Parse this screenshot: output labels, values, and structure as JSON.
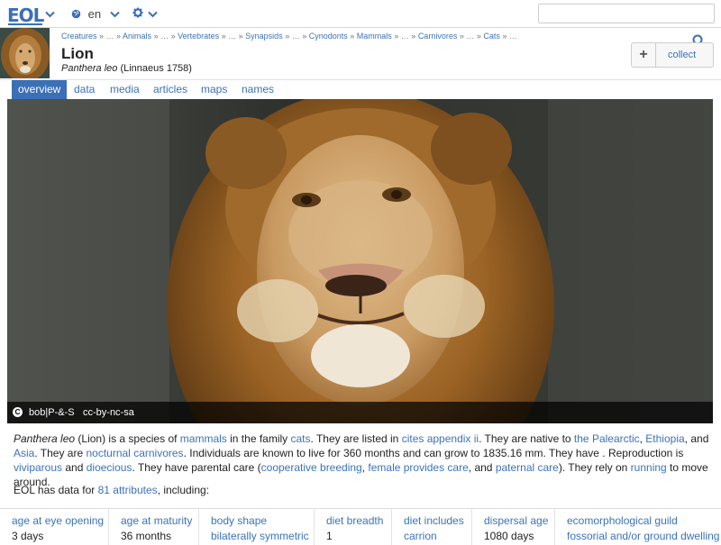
{
  "topbar": {
    "logo": "EOL",
    "language": "en",
    "search_placeholder": ""
  },
  "header": {
    "breadcrumb": [
      "Creatures",
      "…",
      "Animals",
      "…",
      "Vertebrates",
      "…",
      "Synapsids",
      "…",
      "Cynodonts",
      "Mammals",
      "…",
      "Carnivores",
      "…",
      "Cats",
      "…"
    ],
    "title": "Lion",
    "scientific_name": "Panthera leo",
    "authority": "(Linnaeus 1758)",
    "collect_label": "collect"
  },
  "tabs": [
    {
      "label": "overview",
      "active": true
    },
    {
      "label": "data",
      "active": false
    },
    {
      "label": "media",
      "active": false
    },
    {
      "label": "articles",
      "active": false
    },
    {
      "label": "maps",
      "active": false
    },
    {
      "label": "names",
      "active": false
    }
  ],
  "hero": {
    "credit_author": "bob|P-&-S",
    "credit_license": "cc-by-nc-sa"
  },
  "description": {
    "s1": "Panthera leo",
    "s2": " (Lion) is a species of ",
    "l_mammals": "mammals",
    "s3": " in the family ",
    "l_cats": "cats",
    "s4": ". They are listed in ",
    "l_cites": "cites appendix ii",
    "s5": ". They are native to ",
    "l_palearctic": "the Palearctic",
    "s6": ", ",
    "l_ethiopia": "Ethiopia",
    "s7": ", and ",
    "l_asia": "Asia",
    "s8": ". They are ",
    "l_nocturnal": "nocturnal",
    "s9": " ",
    "l_carnivores": "carnivores",
    "s10": ". Individuals are known to live for 360 months and can grow to 1835.16 mm. They have . Reproduction is ",
    "l_viviparous": "viviparous",
    "s11": " and ",
    "l_dioecious": "dioecious",
    "s12": ". They have parental care (",
    "l_coop": "cooperative breeding",
    "s13": ", ",
    "l_female": "female provides care",
    "s14": ", and ",
    "l_paternal": "paternal care",
    "s15": "). They rely on ",
    "l_running": "running",
    "s16": " to move around."
  },
  "data_intro": {
    "prefix": "EOL has data for ",
    "link": "81 attributes",
    "suffix": ", including:"
  },
  "attributes": [
    {
      "name": "age at eye opening",
      "value": "3 days"
    },
    {
      "name": "age at maturity",
      "value": "36 months"
    },
    {
      "name": "body shape",
      "value": "bilaterally symmetric"
    },
    {
      "name": "diet breadth",
      "value": "1"
    },
    {
      "name": "diet includes",
      "value": "carrion"
    },
    {
      "name": "dispersal age",
      "value": "1080 days"
    },
    {
      "name": "ecomorphological guild",
      "value": "fossorial and/or ground dwelling"
    }
  ],
  "colors": {
    "brand": "#3b6fb6",
    "link": "#3b73b9",
    "active_tab": "#3b6fb6"
  },
  "icons": [
    "globe-icon",
    "gear-icon",
    "search-icon",
    "plus-icon",
    "chevron-down-icon",
    "cc-icon"
  ]
}
